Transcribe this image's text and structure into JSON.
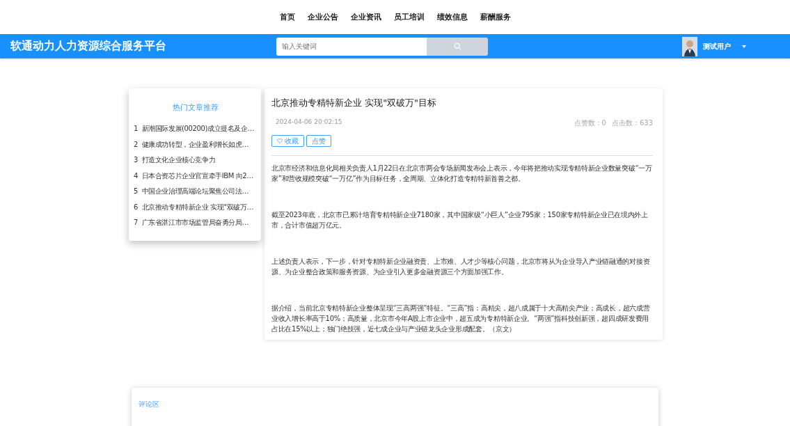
{
  "nav": [
    {
      "label": "首页",
      "selected": false
    },
    {
      "label": "企业公告",
      "selected": false
    },
    {
      "label": "企业资讯",
      "selected": false
    },
    {
      "label": "员工培训",
      "selected": false
    },
    {
      "label": "绩效信息",
      "selected": false
    },
    {
      "label": "薪酬服务",
      "selected": false
    }
  ],
  "header": {
    "title": "软通动力人力资源综合服务平台",
    "search": {
      "placeholder": "输入关键词"
    },
    "user": {
      "name": "测试用户"
    }
  },
  "sidebar": {
    "title": "热门文章推荐",
    "items": [
      {
        "index": "1",
        "title": "新潮国际发展(00200)成立提名及企…"
      },
      {
        "index": "2",
        "title": "健康成功转型，企业盈利增长如虎…"
      },
      {
        "index": "3",
        "title": "打造文化企业核心竞争力"
      },
      {
        "index": "4",
        "title": "日本合资芯片企业官宣牵手IBM 向2…"
      },
      {
        "index": "5",
        "title": "中国企业治理高端论坛聚焦公司法…"
      },
      {
        "index": "6",
        "title": "北京推动专精特新企业 实现\"双破万…"
      },
      {
        "index": "7",
        "title": "广东省湛江市市场监管局奋勇分局…"
      }
    ]
  },
  "article": {
    "title": "北京推动专精特新企业 实现\"双破万\"目标",
    "date": "2024-04-06 20:02:15",
    "likes": "点赞数：0",
    "clicks": "点击数：633",
    "buttons": [
      {
        "label": "收藏",
        "kind": "favorite"
      },
      {
        "label": "点赞",
        "kind": "like"
      }
    ],
    "paragraphs": [
      "北京市经济和信息化局相关负责人1月22日在北京市两会专场新闻发布会上表示，今年将把推动实现专精特新企业数量突破“一万家”和营收规模突破“一万亿”作为目标任务，全周期、立体化打造专精特新首善之都。",
      "截至2023年底，北京市已累计培育专精特新企业7180家，其中国家级“小巨人”企业795家；150家专精特新企业已在境内外上市，合计市值超万亿元。",
      "上述负责人表示，下一步，针对专精特新企业融资贵、上市难、人才少等核心问题，北京市将从为企业导入产业链融通的对接资源、为企业整合政策和服务资源、为企业引入更多金融资源三个方面加强工作。",
      "据介绍，当前北京专精特新企业整体呈现“三高两强”特征。“三高”指：高精尖，超八成属于十大高精尖产业；高成长，超六成营业收入增长率高于10%；高质量，北京市今年A股上市企业中，超五成为专精特新企业。“两强”指科技创新强，超四成研发费用占比在15%以上；独门绝技强，近七成企业与产业链龙头企业形成配套。（京文）"
    ]
  },
  "comments": {
    "title": "评论区"
  }
}
